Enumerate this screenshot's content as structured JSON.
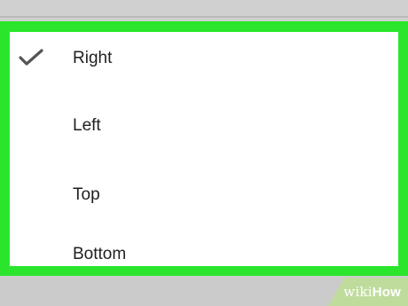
{
  "menu": {
    "items": [
      {
        "label": "Right",
        "selected": true,
        "icon": "check-icon"
      },
      {
        "label": "Left",
        "selected": false
      },
      {
        "label": "Top",
        "selected": false
      },
      {
        "label": "Bottom",
        "selected": false
      }
    ]
  },
  "watermark": {
    "prefix": "wiki",
    "suffix": "How"
  },
  "colors": {
    "highlight_border": "#2ae52b",
    "panel_background": "#ffffff",
    "backdrop": "#cfcfcf",
    "watermark_background": "#bfdc9d"
  }
}
